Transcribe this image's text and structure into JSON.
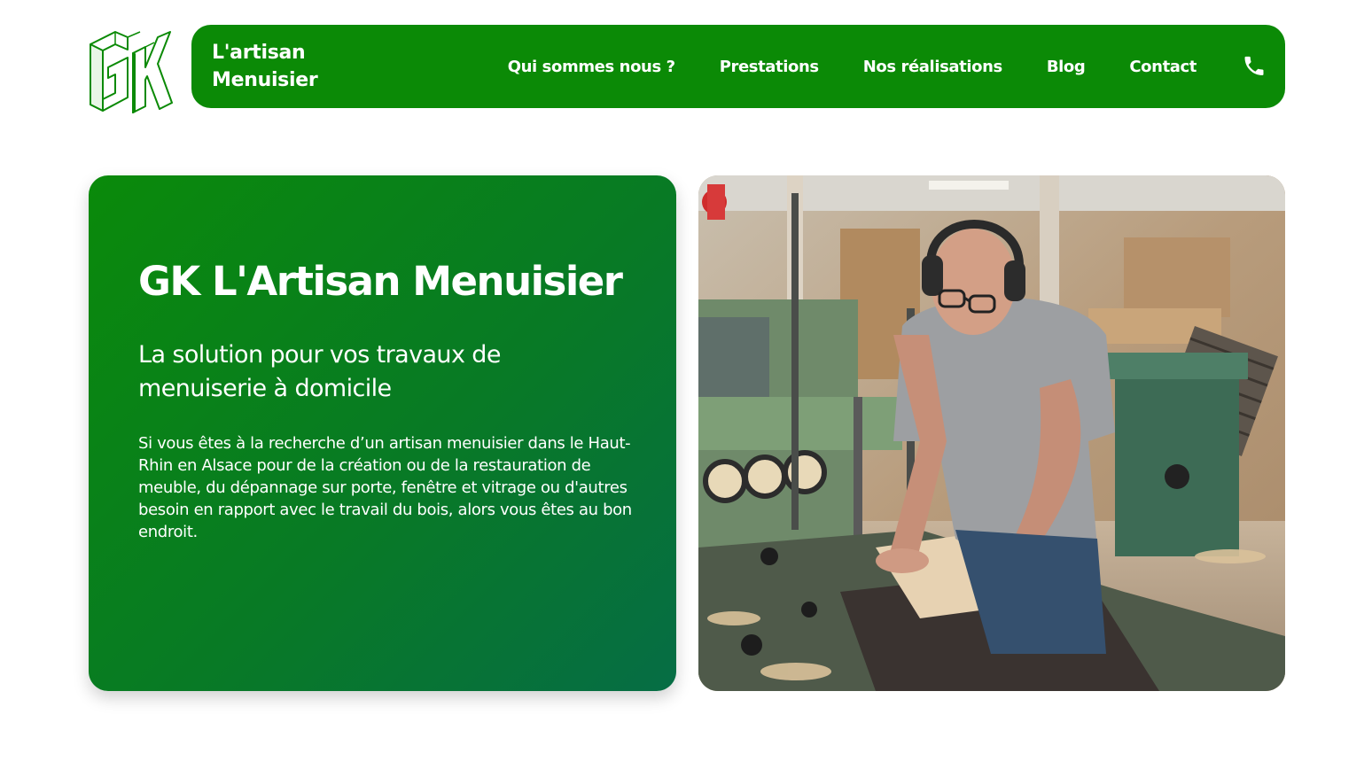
{
  "header": {
    "logo_text": "GK",
    "brand_line1": "L'artisan",
    "brand_line2": "Menuisier",
    "nav": [
      {
        "label": "Qui sommes nous ?"
      },
      {
        "label": "Prestations"
      },
      {
        "label": "Nos réalisations"
      },
      {
        "label": "Blog"
      },
      {
        "label": "Contact"
      }
    ],
    "phone_icon": "phone-icon"
  },
  "hero": {
    "title": "GK L'Artisan Menuisier",
    "subtitle": "La solution pour vos travaux de menuiserie à domicile",
    "text": "Si vous êtes à la recherche d’un artisan menuisier dans le Haut-Rhin en Alsace pour de la création ou de la restauration de meuble, du dépannage sur porte, fenêtre et vitrage ou d'autres besoin en rapport avec le travail du bois, alors vous êtes au bon endroit."
  },
  "colors": {
    "brand_green": "#0b8a06",
    "gradient_end": "#066d45",
    "text_on_green": "#ffffff"
  }
}
